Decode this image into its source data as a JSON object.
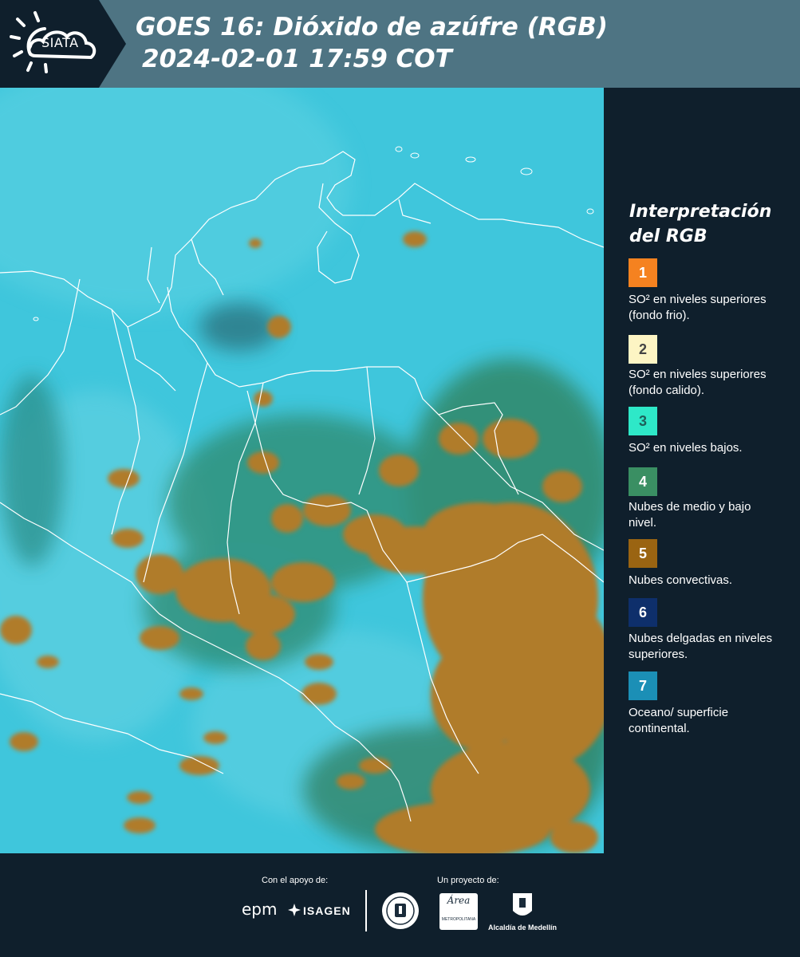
{
  "header": {
    "logo_text": "SIATA",
    "title_line1": "GOES 16: Dióxido de azúfre (RGB)",
    "title_line2": "2024-02-01 17:59 COT"
  },
  "legend": {
    "title_line1": "Interpretación",
    "title_line2": "del RGB",
    "items": [
      {
        "number": "1",
        "color": "#f58220",
        "num_color": "#ffffff",
        "label": "SO² en niveles superiores (fondo frio)."
      },
      {
        "number": "2",
        "color": "#fdf5c4",
        "num_color": "#444444",
        "label": "SO² en niveles superiores (fondo calido)."
      },
      {
        "number": "3",
        "color": "#2ee8c8",
        "num_color": "#1e5f5a",
        "label": "SO² en niveles bajos."
      },
      {
        "number": "4",
        "color": "#3a8f63",
        "num_color": "#ffffff",
        "label": "Nubes de medio y bajo nivel."
      },
      {
        "number": "5",
        "color": "#9a6412",
        "num_color": "#ffffff",
        "label": "Nubes convectivas."
      },
      {
        "number": "6",
        "color": "#0e2f6b",
        "num_color": "#ffffff",
        "label": "Nubes delgadas en niveles superiores."
      },
      {
        "number": "7",
        "color": "#1b8fb6",
        "num_color": "#ffffff",
        "label": "Oceano/ superficie continental."
      }
    ]
  },
  "footer": {
    "support_label": "Con el apoyo de:",
    "project_label": "Un proyecto de:",
    "sponsor_epm": "epm",
    "sponsor_isagen": "ISAGEN",
    "partner_metro": "Área",
    "partner_metro_sub": "METROPOLITANA",
    "partner_alcaldia": "Alcaldía de Medellín"
  },
  "map": {
    "ocean_color": "#3fc6dc",
    "convective_color": "#b07b2c",
    "border_color": "#ffffff"
  }
}
